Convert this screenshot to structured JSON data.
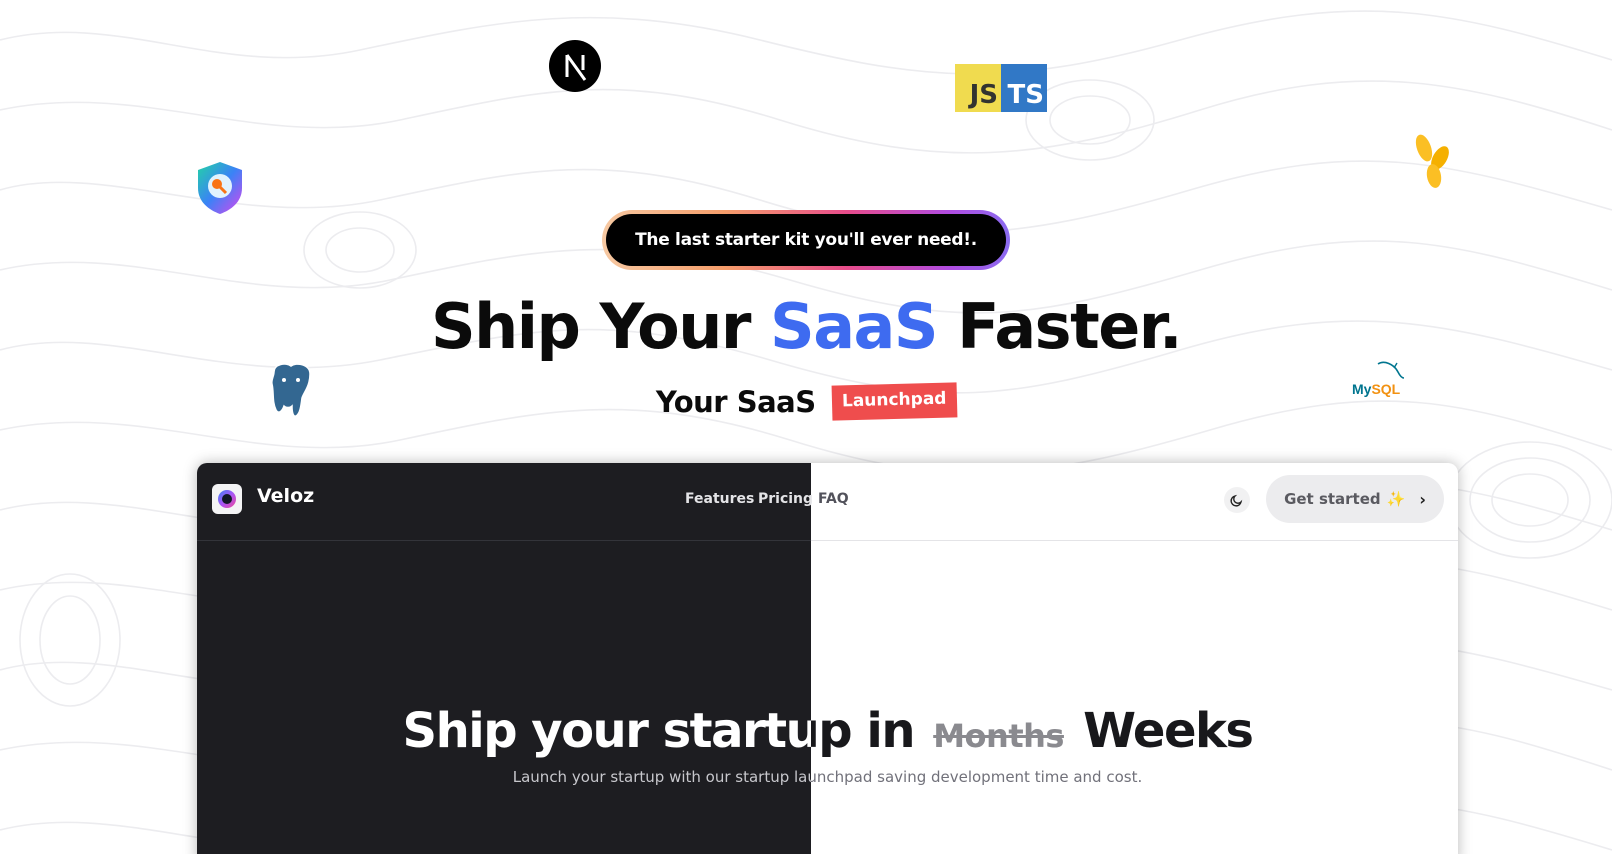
{
  "badge": {
    "text": "The last starter kit you'll ever need!."
  },
  "hero": {
    "title_part1": "Ship Your ",
    "title_accent": "SaaS",
    "title_part2": " Faster.",
    "subtitle": "Your SaaS",
    "subtitle_badge": "Launchpad"
  },
  "logos": {
    "js": "JS",
    "ts": "TS",
    "mysql_my": "My",
    "mysql_sql": "SQL"
  },
  "preview": {
    "brand": "Veloz",
    "nav": {
      "features": "Features",
      "pricing": "Pricing",
      "faq": "FAQ"
    },
    "cta": {
      "label": "Get started",
      "sparkle": "✨",
      "chevron": "›"
    },
    "headline": {
      "main": "Ship your startup in ",
      "struck": "Months",
      "end": " Weeks"
    },
    "description": "Launch your startup with our startup launchpad saving development time and cost."
  },
  "colors": {
    "accent_blue": "#3e6bf0",
    "badge_red": "#ef4d4d",
    "dark_panel": "#1d1d21"
  }
}
